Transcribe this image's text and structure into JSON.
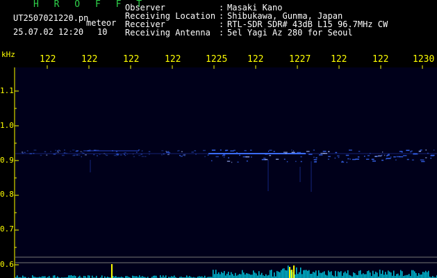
{
  "header": {
    "app_title": "H R O F F T",
    "filename": "UT2507021220.pn",
    "datetime": "25.07.02 12:20",
    "meteor_label": "meteor",
    "meteor_count": "10"
  },
  "info": [
    {
      "label": "Observer",
      "value": "Masaki Kano"
    },
    {
      "label": "Receiving Location",
      "value": "Shibukawa, Gunma, Japan"
    },
    {
      "label": "Receiver",
      "value": "RTL-SDR SDR# 43dB L15 96.7MHz CW"
    },
    {
      "label": "Receiving Antenna",
      "value": "5el Yagi Az 280 for Seoul"
    }
  ],
  "colors": {
    "background": "#000000",
    "plot_background": "#00001a",
    "title_green": "#2fd24a",
    "axis_yellow": "#ffff00",
    "signal_blue": "#3a6cff",
    "baseline_cyan": "#00e6ff"
  },
  "chart_data": {
    "type": "heatmap",
    "y_unit": "kHz",
    "x_ticks": [
      "122",
      "122",
      "122",
      "122",
      "1225",
      "122",
      "1227",
      "122",
      "122",
      "1230"
    ],
    "y_ticks": [
      "1.1",
      "1.0",
      "0.9",
      "0.8",
      "0.7",
      "0.6"
    ],
    "ylim": [
      0.6,
      1.1
    ],
    "signal_band_khz": 0.92,
    "meteor_count": 10
  }
}
